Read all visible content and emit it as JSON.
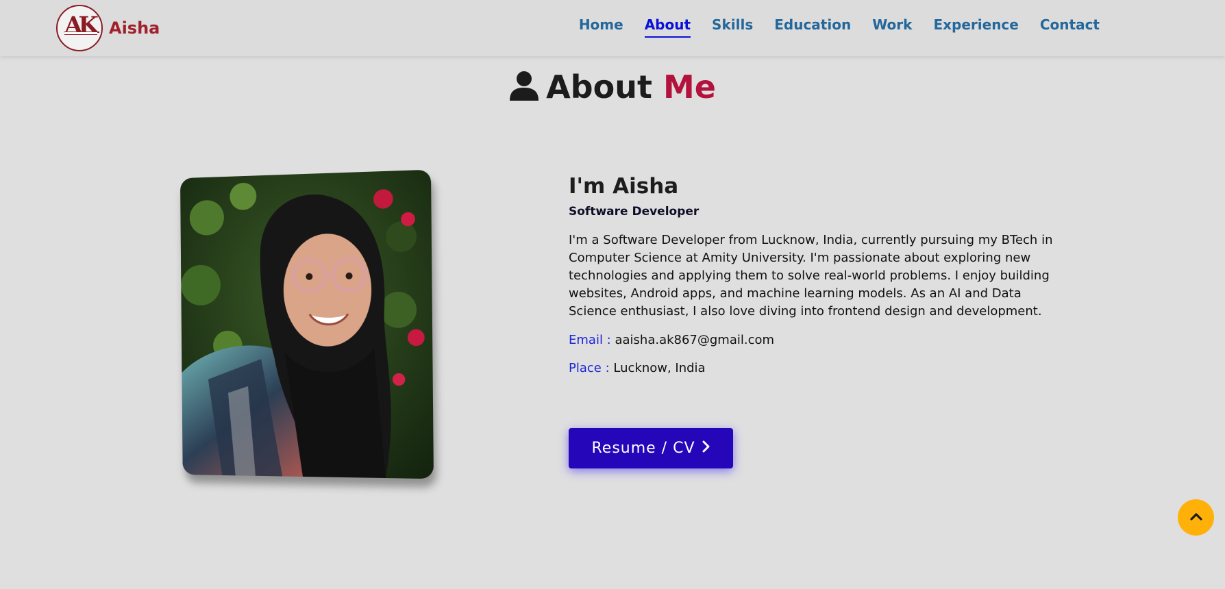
{
  "brand": {
    "name": "Aisha",
    "logo_text": "AK"
  },
  "nav": {
    "items": [
      {
        "label": "Home"
      },
      {
        "label": "About"
      },
      {
        "label": "Skills"
      },
      {
        "label": "Education"
      },
      {
        "label": "Work"
      },
      {
        "label": "Experience"
      },
      {
        "label": "Contact"
      }
    ],
    "active": "About"
  },
  "section": {
    "title": "About",
    "title_accent": "Me",
    "icon": "user-icon"
  },
  "about": {
    "name": "I'm Aisha",
    "role": "Software Developer",
    "bio": "I'm a Software Developer from Lucknow, India, currently pursuing my BTech in Computer Science at Amity University. I'm passionate about exploring new technologies and applying them to solve real-world problems. I enjoy building websites, Android apps, and machine learning models. As an AI and Data Science enthusiast, I also love diving into frontend design and development.",
    "email_label": "Email :",
    "email": "aaisha.ak867@gmail.com",
    "place_label": "Place :",
    "place": "Lucknow, India",
    "resume_label": "Resume / CV"
  },
  "colors": {
    "background": "#dfdfe0",
    "brand": "#a0202c",
    "nav": "#23679b",
    "nav_active": "#0a10d8",
    "accent": "#b3123c",
    "button": "#2506b9",
    "scroll_top": "#ffb109"
  }
}
